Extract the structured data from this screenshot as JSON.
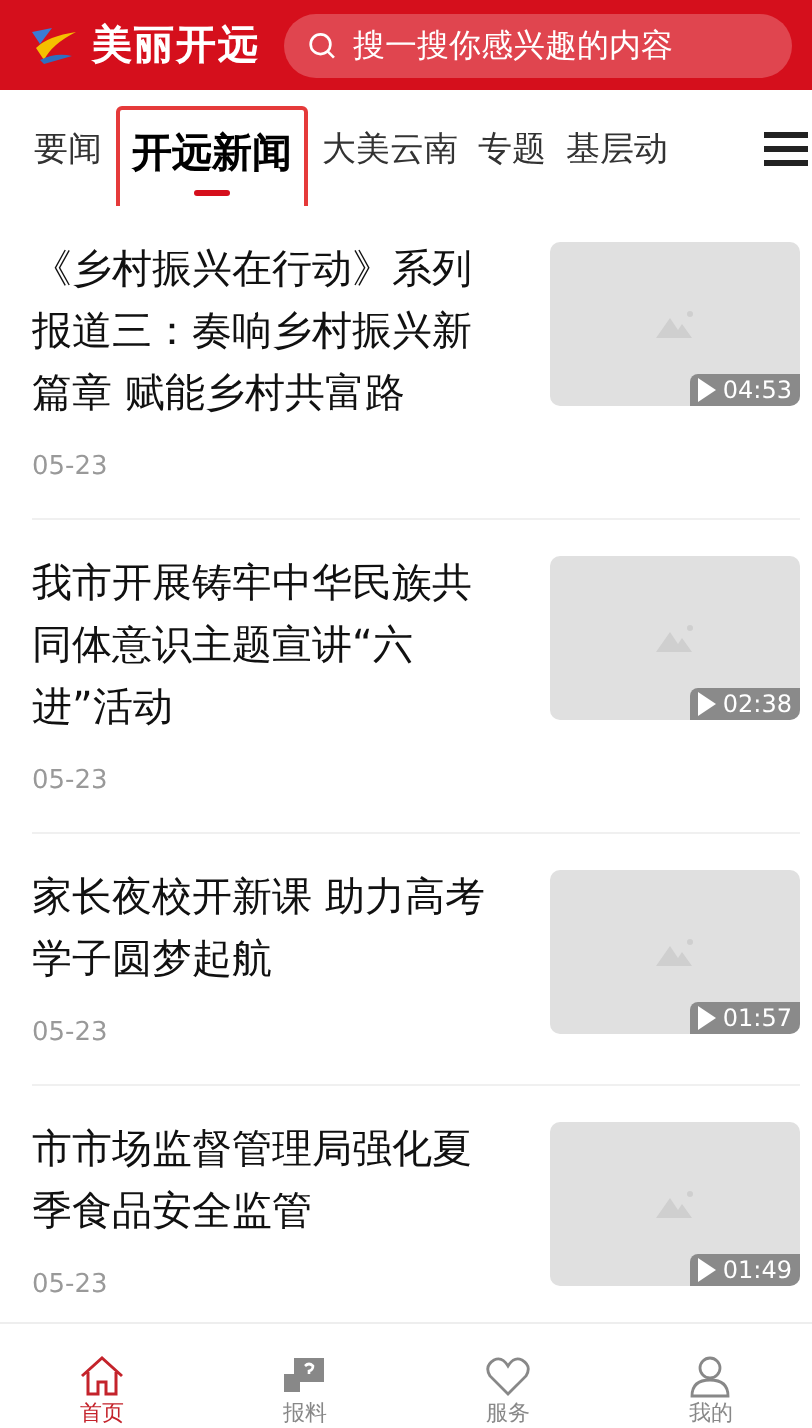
{
  "header": {
    "app_name": "美丽开远",
    "search": {
      "placeholder": "搜一搜你感兴趣的内容"
    }
  },
  "tabs": [
    {
      "label": "要闻",
      "selected": false
    },
    {
      "label": "开远新闻",
      "selected": true
    },
    {
      "label": "大美云南",
      "selected": false
    },
    {
      "label": "专题",
      "selected": false
    },
    {
      "label": "基层动",
      "selected": false
    }
  ],
  "articles": [
    {
      "title": "《乡村振兴在行动》系列报道三：奏响乡村振兴新篇章 赋能乡村共富路",
      "date": "05-23",
      "duration": "04:53"
    },
    {
      "title": "我市开展铸牢中华民族共同体意识主题宣讲“六进”活动",
      "date": "05-23",
      "duration": "02:38"
    },
    {
      "title": "家长夜校开新课 助力高考学子圆梦起航",
      "date": "05-23",
      "duration": "01:57"
    },
    {
      "title": "市市场监督管理局强化夏季食品安全监管",
      "date": "05-23",
      "duration": "01:49"
    }
  ],
  "bottom_nav": [
    {
      "label": "首页",
      "kind": "home",
      "selected": true
    },
    {
      "label": "报料",
      "kind": "report",
      "selected": false
    },
    {
      "label": "服务",
      "kind": "heart",
      "selected": false
    },
    {
      "label": "我的",
      "kind": "person",
      "selected": false
    }
  ]
}
